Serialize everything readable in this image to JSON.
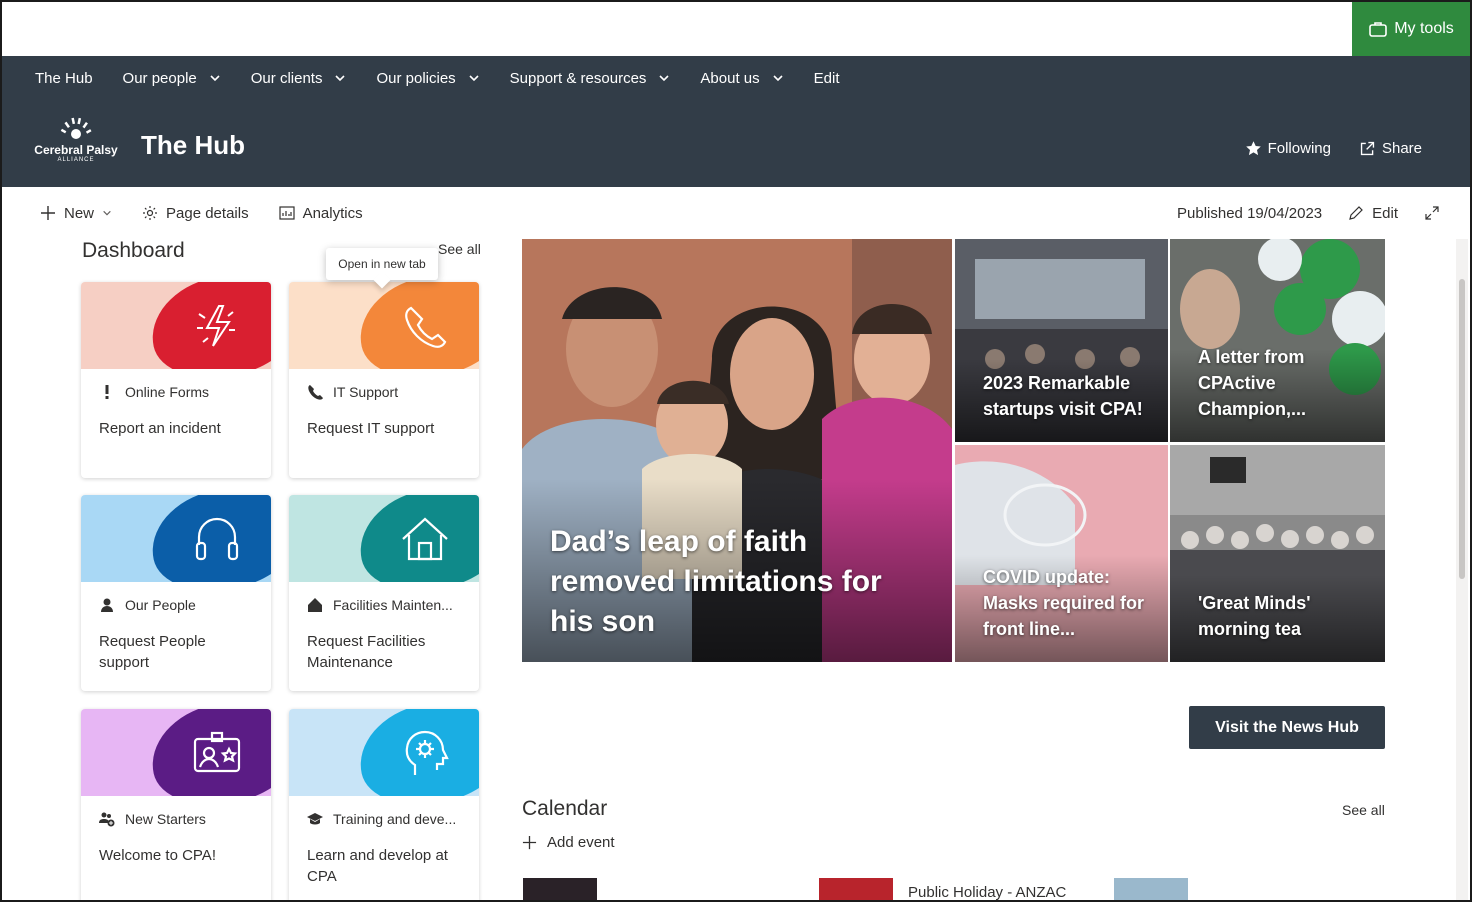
{
  "topbar": {
    "my_tools": "My tools"
  },
  "nav": {
    "items": [
      {
        "label": "The Hub",
        "has_menu": false
      },
      {
        "label": "Our people",
        "has_menu": true
      },
      {
        "label": "Our clients",
        "has_menu": true
      },
      {
        "label": "Our policies",
        "has_menu": true
      },
      {
        "label": "Support & resources",
        "has_menu": true
      },
      {
        "label": "About us",
        "has_menu": true
      },
      {
        "label": "Edit",
        "has_menu": false
      }
    ]
  },
  "header": {
    "logo_name": "Cerebral Palsy",
    "logo_sub": "ALLIANCE",
    "site_title": "The Hub",
    "following": "Following",
    "share": "Share"
  },
  "command_bar": {
    "new": "New",
    "page_details": "Page details",
    "analytics": "Analytics",
    "published": "Published 19/04/2023",
    "edit": "Edit"
  },
  "dashboard": {
    "title": "Dashboard",
    "see_all": "See all",
    "tooltip": "Open in new tab",
    "cards": [
      {
        "category": "Online Forms",
        "title": "Report an incident",
        "bg": "#f6cfc4",
        "blob": "#d91f30",
        "icon": "lightning-icon",
        "cat_icon": "exclamation-icon"
      },
      {
        "category": "IT Support",
        "title": "Request IT support",
        "bg": "#fcdfc8",
        "blob": "#f3873a",
        "icon": "phone-icon",
        "cat_icon": "phone-icon"
      },
      {
        "category": "Our People",
        "title": "Request People support",
        "bg": "#a9d8f5",
        "blob": "#0b5ea8",
        "icon": "headset-icon",
        "cat_icon": "person-icon"
      },
      {
        "category": "Facilities Mainten...",
        "title": "Request Facilities Maintenance",
        "bg": "#bfe5e2",
        "blob": "#0f8a8a",
        "icon": "house-icon",
        "cat_icon": "home-icon"
      },
      {
        "category": "New Starters",
        "title": "Welcome to CPA!",
        "bg": "#e7b6f4",
        "blob": "#5b1c85",
        "icon": "id-badge-icon",
        "cat_icon": "people-add-icon"
      },
      {
        "category": "Training and deve...",
        "title": "Learn and develop at CPA",
        "bg": "#c8e4f7",
        "blob": "#1aaee3",
        "icon": "head-gear-icon",
        "cat_icon": "graduation-cap-icon"
      }
    ]
  },
  "news": {
    "hero": "Dad’s leap of faith removed limitations for his son",
    "tiles": [
      "2023 Remarkable startups visit CPA!",
      "A letter from CPActive Champion,...",
      "COVID update: Masks required for front line...",
      "'Great Minds' morning tea"
    ],
    "button": "Visit the News Hub"
  },
  "calendar": {
    "title": "Calendar",
    "see_all": "See all",
    "add_event": "Add event",
    "events": [
      {
        "title": "Public Holiday - ANZAC"
      }
    ]
  },
  "colors": {
    "brand_dark": "#323d48",
    "my_tools_green": "#2f8a3e"
  }
}
